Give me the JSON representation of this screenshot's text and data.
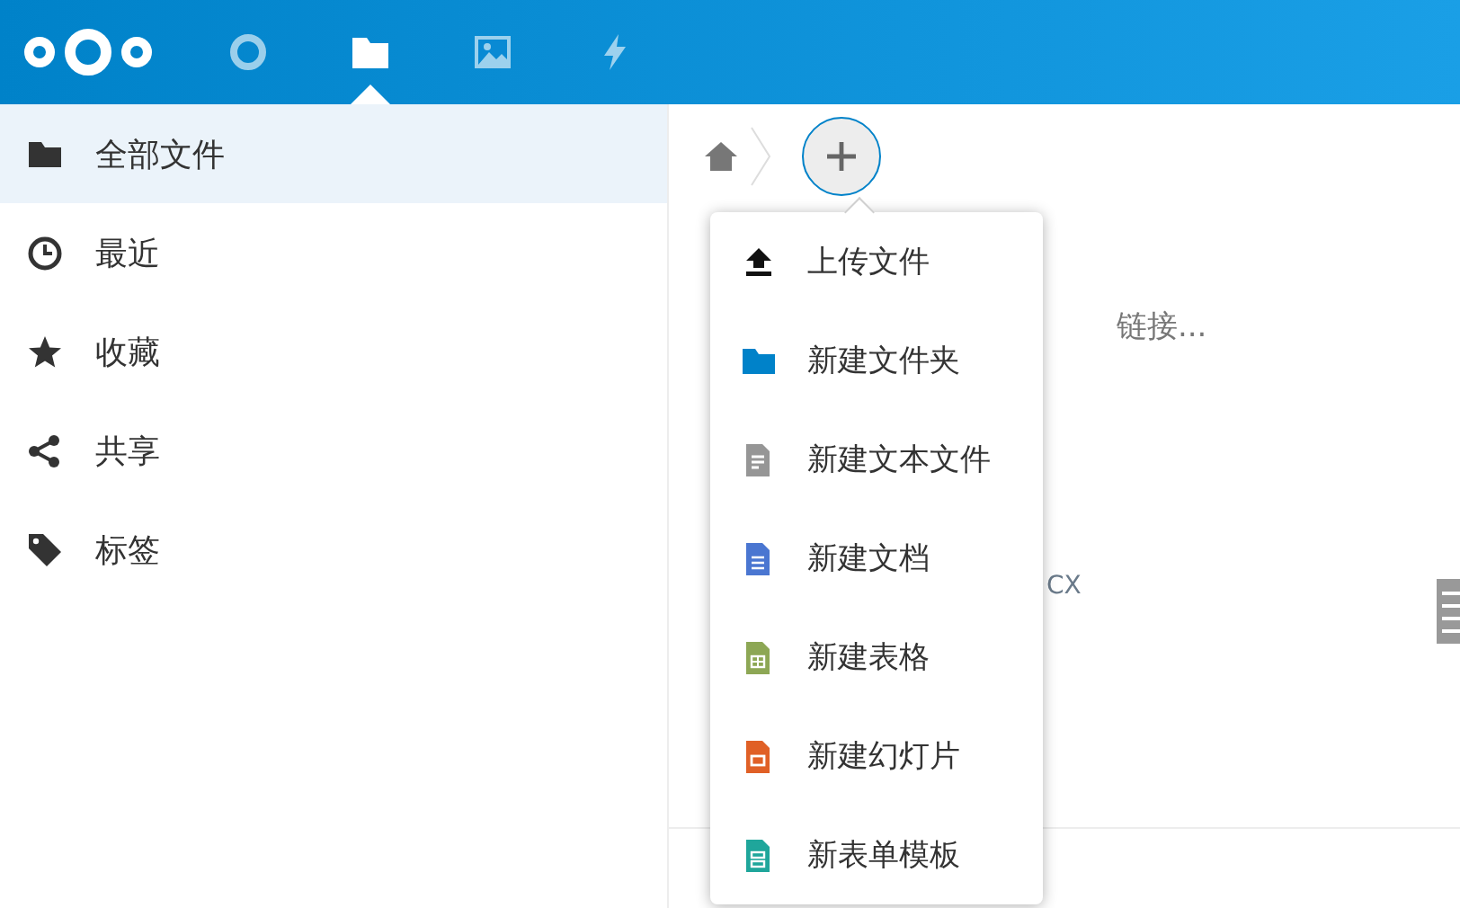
{
  "header": {
    "apps": [
      {
        "kind": "activity",
        "selected": false
      },
      {
        "kind": "files",
        "selected": true
      },
      {
        "kind": "photos",
        "selected": false
      },
      {
        "kind": "flash",
        "selected": false
      }
    ]
  },
  "sidebar": {
    "items": [
      {
        "kind": "folder",
        "label": "全部文件",
        "selected": true
      },
      {
        "kind": "recent",
        "label": "最近",
        "selected": false
      },
      {
        "kind": "favorite",
        "label": "收藏",
        "selected": false
      },
      {
        "kind": "share",
        "label": "共享",
        "selected": false
      },
      {
        "kind": "tag",
        "label": "标签",
        "selected": false
      }
    ]
  },
  "content": {
    "background_texts": [
      "链接...",
      "CX"
    ]
  },
  "new_menu": {
    "items": [
      {
        "kind": "upload",
        "label": "上传文件"
      },
      {
        "kind": "folder",
        "label": "新建文件夹"
      },
      {
        "kind": "text",
        "label": "新建文本文件"
      },
      {
        "kind": "document",
        "label": "新建文档"
      },
      {
        "kind": "spreadsheet",
        "label": "新建表格"
      },
      {
        "kind": "presentation",
        "label": "新建幻灯片"
      },
      {
        "kind": "form",
        "label": "新表单模板"
      }
    ]
  }
}
